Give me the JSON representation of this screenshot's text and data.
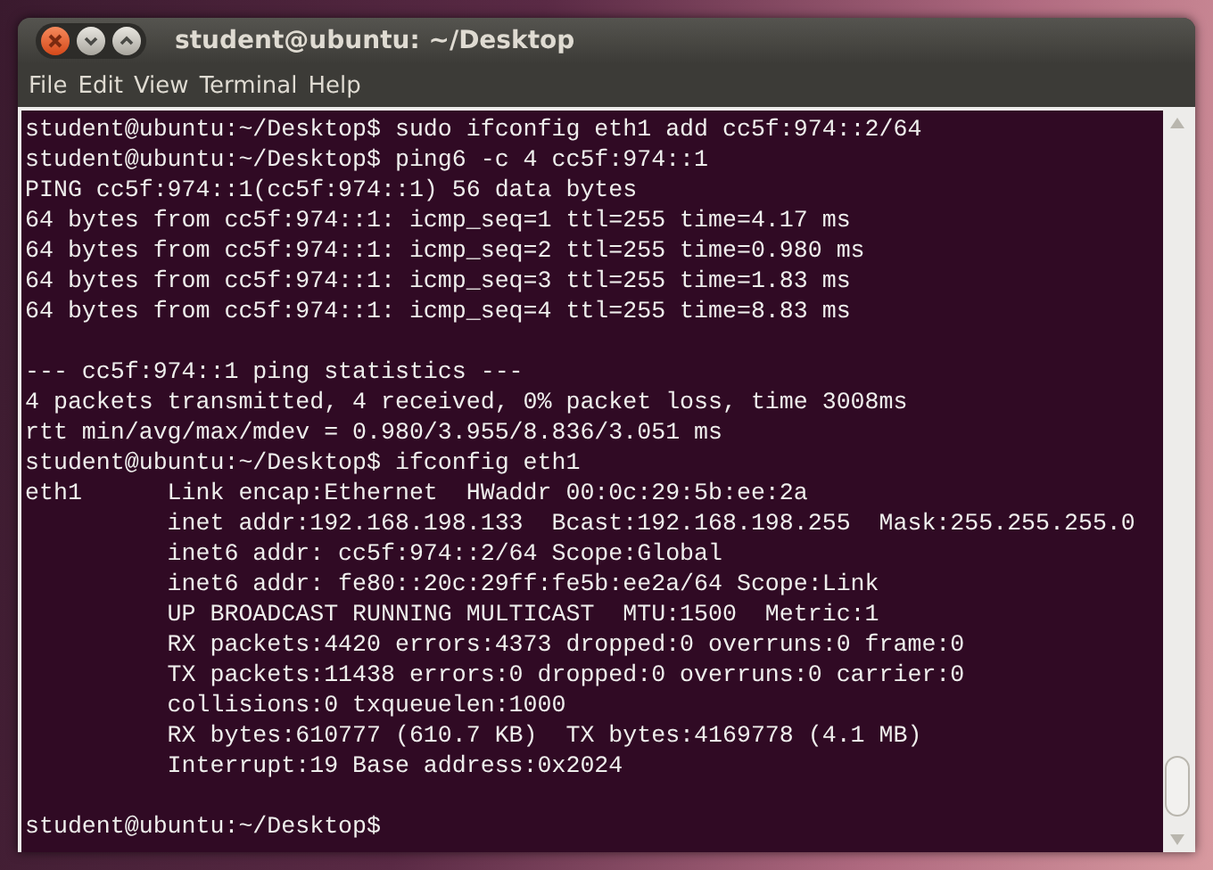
{
  "window": {
    "title": "student@ubuntu: ~/Desktop"
  },
  "menu": [
    "File",
    "Edit",
    "View",
    "Terminal",
    "Help"
  ],
  "terminal": {
    "blocks": [
      [
        "student@ubuntu:~/Desktop$ sudo ifconfig eth1 add cc5f:974::2/64",
        "student@ubuntu:~/Desktop$ ping6 -c 4 cc5f:974::1",
        "PING cc5f:974::1(cc5f:974::1) 56 data bytes",
        "64 bytes from cc5f:974::1: icmp_seq=1 ttl=255 time=4.17 ms",
        "64 bytes from cc5f:974::1: icmp_seq=2 ttl=255 time=0.980 ms",
        "64 bytes from cc5f:974::1: icmp_seq=3 ttl=255 time=1.83 ms",
        "64 bytes from cc5f:974::1: icmp_seq=4 ttl=255 time=8.83 ms"
      ],
      [
        "--- cc5f:974::1 ping statistics ---",
        "4 packets transmitted, 4 received, 0% packet loss, time 3008ms",
        "rtt min/avg/max/mdev = 0.980/3.955/8.836/3.051 ms",
        "student@ubuntu:~/Desktop$ ifconfig eth1",
        "eth1      Link encap:Ethernet  HWaddr 00:0c:29:5b:ee:2a",
        "          inet addr:192.168.198.133  Bcast:192.168.198.255  Mask:255.255.255.0",
        "          inet6 addr: cc5f:974::2/64 Scope:Global",
        "          inet6 addr: fe80::20c:29ff:fe5b:ee2a/64 Scope:Link",
        "          UP BROADCAST RUNNING MULTICAST  MTU:1500  Metric:1",
        "          RX packets:4420 errors:4373 dropped:0 overruns:0 frame:0",
        "          TX packets:11438 errors:0 dropped:0 overruns:0 carrier:0",
        "          collisions:0 txqueuelen:1000",
        "          RX bytes:610777 (610.7 KB)  TX bytes:4169778 (4.1 MB)",
        "          Interrupt:19 Base address:0x2024"
      ],
      [
        "student@ubuntu:~/Desktop$"
      ]
    ]
  }
}
